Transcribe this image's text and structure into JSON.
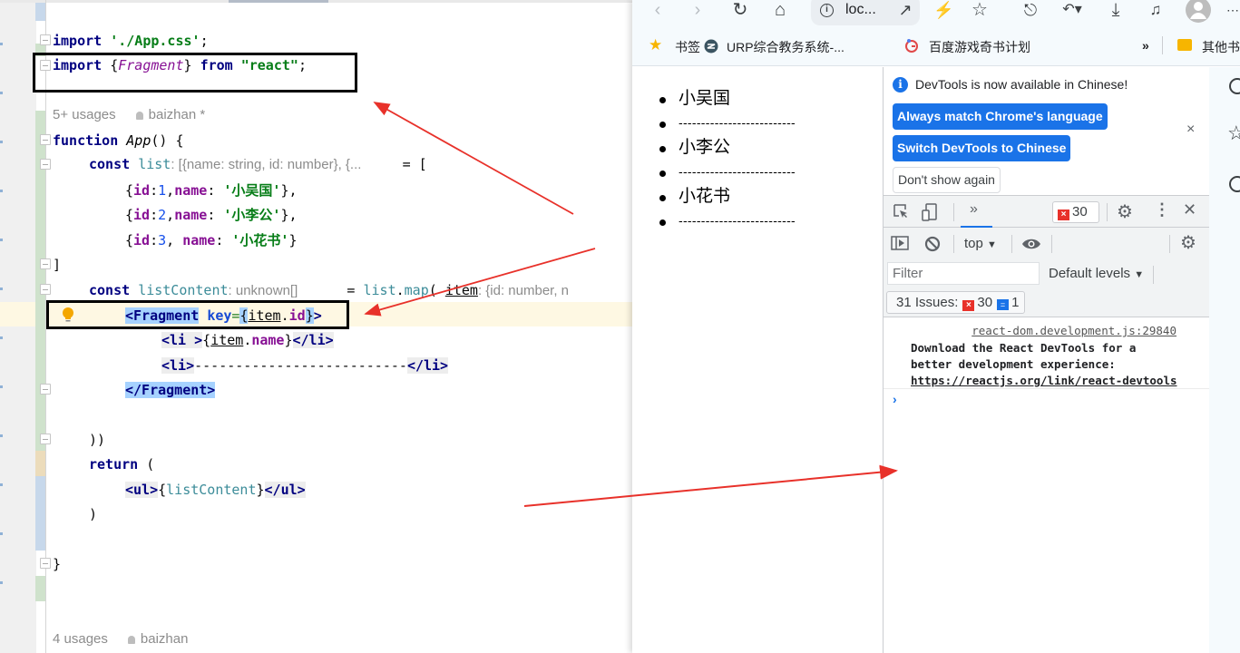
{
  "ide": {
    "code_lines": {
      "l1": {
        "kw": "import",
        "str": "'./App.css'",
        "end": ";"
      },
      "l2": {
        "kw": "import",
        "open": "{",
        "ident": "Fragment",
        "close": "}",
        "from": "from",
        "str": "\"react\"",
        "end": ";"
      },
      "usages_top": "5+ usages",
      "author_top": "baizhan *",
      "l3": {
        "kw": "function",
        "name": "App",
        "rest": "() {"
      },
      "l4": {
        "kw": "const",
        "var": "list",
        "hint": ": [{name: string, id: number}, {...",
        "rest": " = ["
      },
      "items": [
        {
          "pre": "{",
          "k1": "id",
          "sep1": ":",
          "v1": "1",
          "sep2": ",",
          "k2": "name",
          "sep3": ": ",
          "v2": "'小吴国'",
          "post": "},"
        },
        {
          "pre": "{",
          "k1": "id",
          "sep1": ":",
          "v1": "2",
          "sep2": ",",
          "k2": "name",
          "sep3": ": ",
          "v2": "'小李公'",
          "post": "},"
        },
        {
          "pre": "{",
          "k1": "id",
          "sep1": ":",
          "v1": "3",
          "sep2": ", ",
          "k2": "name",
          "sep3": ": ",
          "v2": "'小花书'",
          "post": "}"
        }
      ],
      "l8": "]",
      "l9": {
        "kw": "const",
        "var": "listContent",
        "hint": ": unknown[]",
        "eq": " = ",
        "obj": "list",
        "dot": ".",
        "method": "map",
        "paren": "( ",
        "param": "item",
        "hint2": ": {id: number, n"
      },
      "l10": {
        "open": "<Fragment",
        "attr": "key",
        "eq": "=",
        "lb": "{",
        "obj": "item",
        "dot": ".",
        "prop": "id",
        "rb": "}",
        "close": ">"
      },
      "l11": {
        "open": "<li ",
        "gt": ">",
        "lb": "{",
        "obj": "item",
        "dot": ".",
        "prop": "name",
        "rb": "}",
        "close": "</li>"
      },
      "l12": {
        "open": "<li>",
        "dashes": "--------------------------",
        "close": "</li>"
      },
      "l13": "</Fragment>",
      "l15": "))",
      "l16": {
        "kw": "return",
        "rest": " ("
      },
      "l17": {
        "open": "<ul>",
        "lb": "{",
        "var": "listContent",
        "rb": "}",
        "close": "</ul>"
      },
      "l18": ")",
      "l20": "}",
      "usages_bottom": "4 usages",
      "author_bottom": "baizhan"
    }
  },
  "browser": {
    "toolbar": {
      "url": "loc..."
    },
    "bookmarks": [
      {
        "label": "书签",
        "icon": "star-icon"
      },
      {
        "label": "URP综合教务系统-...",
        "icon": "urp-logo-icon"
      },
      {
        "label": "百度游戏奇书计划",
        "icon": "baidu-game-icon"
      },
      {
        "label": "»",
        "icon": "more-bookmarks-icon"
      },
      {
        "label": "其他书",
        "icon": "folder-icon"
      }
    ],
    "page_list": [
      "小吴国",
      "--------------------------",
      "小李公",
      "--------------------------",
      "小花书",
      "--------------------------"
    ],
    "devtools": {
      "infobar": {
        "message": "DevTools is now available in Chinese!",
        "btn_match": "Always match Chrome's language",
        "btn_switch": "Switch DevTools to Chinese",
        "btn_dont_show": "Don't show again",
        "close": "×"
      },
      "tabbar": {
        "more_tabs": "»",
        "error_count": "30"
      },
      "console_bar": {
        "context": "top",
        "filter_placeholder": "Filter",
        "levels": "Default levels",
        "issues_label": "31 Issues:",
        "issues_errors": "30",
        "issues_info": "1"
      },
      "message": {
        "source": "react-dom.development.js:29840",
        "text": "Download the React DevTools for a better development experience: ",
        "link": "https://reactjs.org/link/react-devtools"
      },
      "prompt": "›"
    }
  },
  "colors": {
    "annotation_arrow": "#e8312a",
    "chrome_blue": "#1a73e8",
    "caret_line": "#fef8e3",
    "selection": "#a6d2ff"
  }
}
